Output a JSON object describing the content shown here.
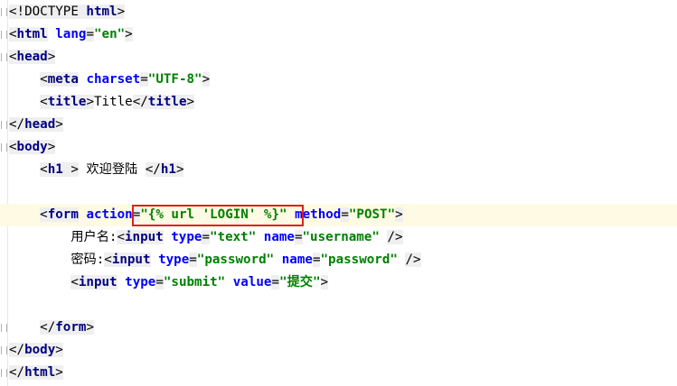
{
  "editor": {
    "lines": [
      {
        "indent": "",
        "parts": [
          [
            "br",
            "<"
          ],
          [
            "doctype",
            "!DOCTYPE "
          ],
          [
            "tag",
            "html"
          ],
          [
            "br",
            ">"
          ]
        ]
      },
      {
        "indent": "",
        "parts": [
          [
            "br",
            "<"
          ],
          [
            "tag",
            "html"
          ],
          [
            "sp",
            " "
          ],
          [
            "attr",
            "lang"
          ],
          [
            "br",
            "="
          ],
          [
            "val",
            "\"en\""
          ],
          [
            "br",
            ">"
          ]
        ]
      },
      {
        "indent": "",
        "parts": [
          [
            "br",
            "<"
          ],
          [
            "tag",
            "head"
          ],
          [
            "br",
            ">"
          ]
        ]
      },
      {
        "indent": "    ",
        "parts": [
          [
            "br",
            "<"
          ],
          [
            "tag",
            "meta"
          ],
          [
            "sp",
            " "
          ],
          [
            "attr",
            "charset"
          ],
          [
            "br",
            "="
          ],
          [
            "val",
            "\"UTF-8\""
          ],
          [
            "br",
            ">"
          ]
        ]
      },
      {
        "indent": "    ",
        "parts": [
          [
            "br",
            "<"
          ],
          [
            "tag",
            "title"
          ],
          [
            "br",
            ">"
          ],
          [
            "txt",
            "Title"
          ],
          [
            "br",
            "</"
          ],
          [
            "tag",
            "title"
          ],
          [
            "br",
            ">"
          ]
        ]
      },
      {
        "indent": "",
        "parts": [
          [
            "br",
            "</"
          ],
          [
            "tag",
            "head"
          ],
          [
            "br",
            ">"
          ]
        ]
      },
      {
        "indent": "",
        "parts": [
          [
            "br",
            "<"
          ],
          [
            "tag",
            "body"
          ],
          [
            "br",
            ">"
          ]
        ]
      },
      {
        "indent": "    ",
        "parts": [
          [
            "br",
            "<"
          ],
          [
            "tag",
            "h1"
          ],
          [
            "br",
            " >"
          ],
          [
            "txt",
            " 欢迎登陆 "
          ],
          [
            "br",
            "</"
          ],
          [
            "tag",
            "h1"
          ],
          [
            "br",
            ">"
          ]
        ]
      },
      {
        "indent": "",
        "parts": []
      },
      {
        "indent": "    ",
        "current": true,
        "parts": [
          [
            "br",
            "<"
          ],
          [
            "tag",
            "form"
          ],
          [
            "sp",
            " "
          ],
          [
            "attr",
            "action"
          ],
          [
            "br",
            "="
          ],
          [
            "val",
            "\"{% url 'LOGIN' %}\""
          ],
          [
            "sp",
            " "
          ],
          [
            "attr",
            "method"
          ],
          [
            "br",
            "="
          ],
          [
            "val",
            "\"POST\""
          ],
          [
            "br",
            ">"
          ]
        ]
      },
      {
        "indent": "        ",
        "parts": [
          [
            "txt",
            "用户名:"
          ],
          [
            "br",
            "<"
          ],
          [
            "tag",
            "input"
          ],
          [
            "sp",
            " "
          ],
          [
            "attr",
            "type"
          ],
          [
            "br",
            "="
          ],
          [
            "val",
            "\"text\""
          ],
          [
            "sp",
            " "
          ],
          [
            "attr",
            "name"
          ],
          [
            "br",
            "="
          ],
          [
            "val",
            "\"username\""
          ],
          [
            "sp",
            " "
          ],
          [
            "br",
            "/>"
          ]
        ]
      },
      {
        "indent": "        ",
        "parts": [
          [
            "txt",
            "密码:"
          ],
          [
            "br",
            "<"
          ],
          [
            "tag",
            "input"
          ],
          [
            "sp",
            " "
          ],
          [
            "attr",
            "type"
          ],
          [
            "br",
            "="
          ],
          [
            "val",
            "\"password\""
          ],
          [
            "sp",
            " "
          ],
          [
            "attr",
            "name"
          ],
          [
            "br",
            "="
          ],
          [
            "val",
            "\"password\""
          ],
          [
            "sp",
            " "
          ],
          [
            "br",
            "/>"
          ]
        ]
      },
      {
        "indent": "        ",
        "parts": [
          [
            "br",
            "<"
          ],
          [
            "tag",
            "input"
          ],
          [
            "sp",
            " "
          ],
          [
            "attr",
            "type"
          ],
          [
            "br",
            "="
          ],
          [
            "val",
            "\"submit\""
          ],
          [
            "sp",
            " "
          ],
          [
            "attr",
            "value"
          ],
          [
            "br",
            "="
          ],
          [
            "val",
            "\"提交\""
          ],
          [
            "br",
            ">"
          ]
        ]
      },
      {
        "indent": "",
        "parts": []
      },
      {
        "indent": "    ",
        "parts": [
          [
            "br",
            "</"
          ],
          [
            "tag",
            "form"
          ],
          [
            "br",
            ">"
          ]
        ]
      },
      {
        "indent": "",
        "parts": [
          [
            "br",
            "</"
          ],
          [
            "tag",
            "body"
          ],
          [
            "br",
            ">"
          ]
        ]
      },
      {
        "indent": "",
        "parts": [
          [
            "br",
            "</"
          ],
          [
            "tag",
            "html"
          ],
          [
            "br",
            ">"
          ]
        ]
      }
    ]
  },
  "colors": {
    "tag": "#000080",
    "attribute": "#0000ff",
    "value": "#008000",
    "current_line": "#fffae3",
    "highlight_box": "#e02020"
  }
}
